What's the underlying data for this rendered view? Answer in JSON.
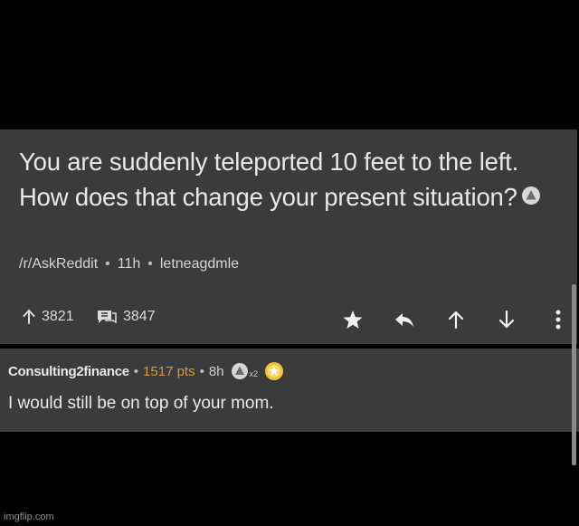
{
  "post": {
    "title": "You are suddenly teleported 10 feet to the left. How does that change your present situation?",
    "subreddit": "/r/AskReddit",
    "age": "11h",
    "author": "letneagdmle",
    "upvotes": "3821",
    "comments": "3847",
    "action_icons": [
      "star-icon",
      "reply-icon",
      "upvote-arrow-icon",
      "downvote-arrow-icon",
      "more-vertical-icon"
    ]
  },
  "comment": {
    "username": "Consulting2finance",
    "points": "1517 pts",
    "age": "8h",
    "award_multiplier": "x2",
    "body": "I would still be on top of your mom."
  },
  "watermark": "imgflip.com",
  "colors": {
    "background": "#000000",
    "card": "#3b3b3d",
    "text": "#e8e8e8",
    "points": "#d3993a",
    "gold": "#f2c230"
  }
}
